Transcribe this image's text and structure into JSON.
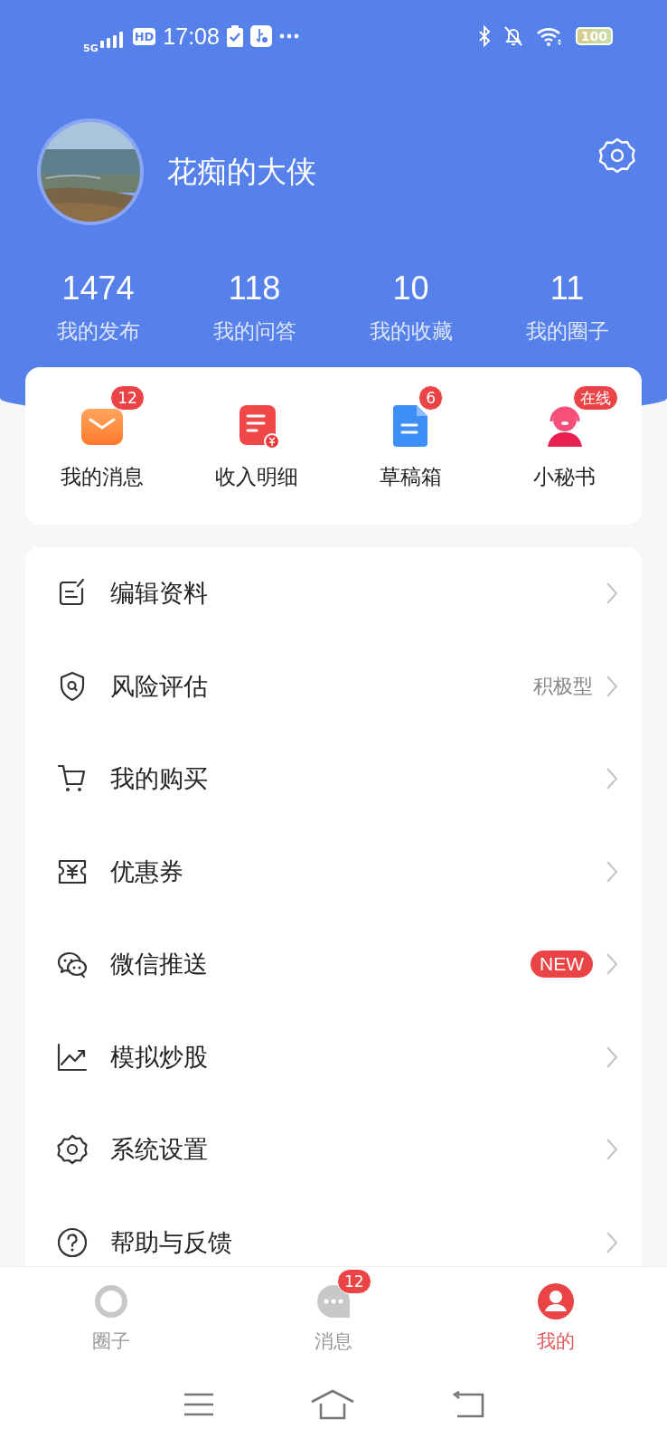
{
  "status_bar": {
    "network": "5G",
    "hd": "HD",
    "time": "17:08",
    "battery": "100"
  },
  "profile": {
    "name": "花痴的大侠"
  },
  "stats": [
    {
      "value": "1474",
      "label": "我的发布"
    },
    {
      "value": "118",
      "label": "我的问答"
    },
    {
      "value": "10",
      "label": "我的收藏"
    },
    {
      "value": "11",
      "label": "我的圈子"
    }
  ],
  "shortcuts": [
    {
      "label": "我的消息",
      "kind": "mail",
      "badge": "12"
    },
    {
      "label": "收入明细",
      "kind": "income"
    },
    {
      "label": "草稿箱",
      "kind": "doc",
      "badge": "6"
    },
    {
      "label": "小秘书",
      "kind": "agent",
      "badge": "在线"
    }
  ],
  "menu": [
    {
      "label": "编辑资料",
      "kind": "edit"
    },
    {
      "label": "风险评估",
      "kind": "shield",
      "value": "积极型"
    },
    {
      "label": "我的购买",
      "kind": "cart"
    },
    {
      "label": "优惠券",
      "kind": "coupon"
    },
    {
      "label": "微信推送",
      "kind": "wechat",
      "tag": "NEW"
    },
    {
      "label": "模拟炒股",
      "kind": "chart"
    },
    {
      "label": "系统设置",
      "kind": "gear"
    },
    {
      "label": "帮助与反馈",
      "kind": "help"
    }
  ],
  "tabs": [
    {
      "label": "圈子",
      "kind": "ring",
      "selected": false
    },
    {
      "label": "消息",
      "kind": "chat",
      "badge": "12",
      "selected": false
    },
    {
      "label": "我的",
      "kind": "person",
      "selected": true
    }
  ]
}
